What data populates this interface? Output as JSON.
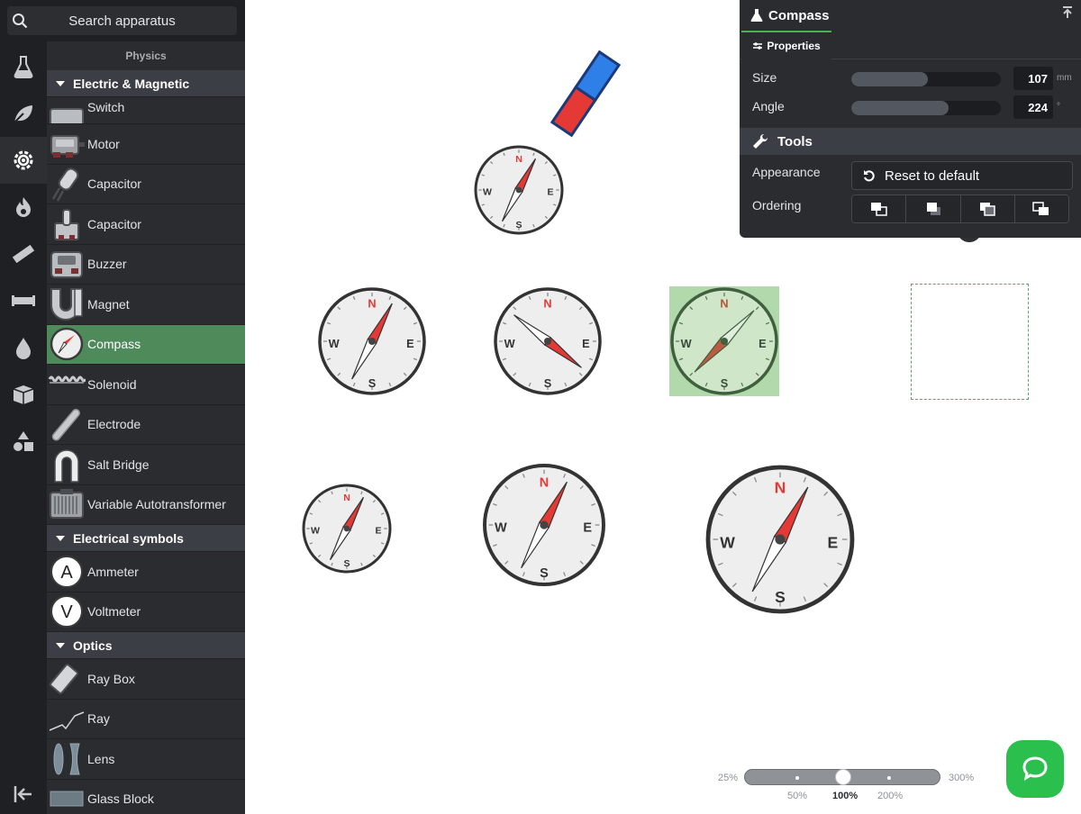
{
  "search": {
    "placeholder": "Search apparatus"
  },
  "panel": {
    "title": "Physics"
  },
  "sections": {
    "electric": "Electric & Magnetic",
    "symbols": "Electrical symbols",
    "optics": "Optics"
  },
  "items": {
    "switch": "Switch",
    "motor": "Motor",
    "capacitor1": "Capacitor",
    "capacitor2": "Capacitor",
    "buzzer": "Buzzer",
    "magnet": "Magnet",
    "compass": "Compass",
    "solenoid": "Solenoid",
    "electrode": "Electrode",
    "salt_bridge": "Salt Bridge",
    "autotransformer": "Variable Autotransformer",
    "ammeter": "Ammeter",
    "voltmeter": "Voltmeter",
    "ray_box": "Ray Box",
    "ray": "Ray",
    "lens": "Lens",
    "glass_block": "Glass Block"
  },
  "props": {
    "title": "Compass",
    "tab": "Properties",
    "size_label": "Size",
    "size_value": "107",
    "size_unit": "mm",
    "size_fill": 0.51,
    "angle_label": "Angle",
    "angle_value": "224",
    "angle_unit": "°",
    "angle_fill": 0.65,
    "tools_label": "Tools",
    "appearance_label": "Appearance",
    "reset_label": "Reset to default",
    "ordering_label": "Ordering"
  },
  "compass_letters": {
    "n": "N",
    "s": "S",
    "e": "E",
    "w": "W"
  },
  "zoom": {
    "min": "25%",
    "max": "300%",
    "t50": "50%",
    "t100": "100%",
    "t200": "200%",
    "value": "100%"
  },
  "colors": {
    "accent": "#4caf50",
    "selected": "#4f8a5b",
    "needle": "#e53935",
    "magnet_red": "#e53935",
    "magnet_blue": "#1e88e5",
    "chat": "#2bbf4e"
  }
}
